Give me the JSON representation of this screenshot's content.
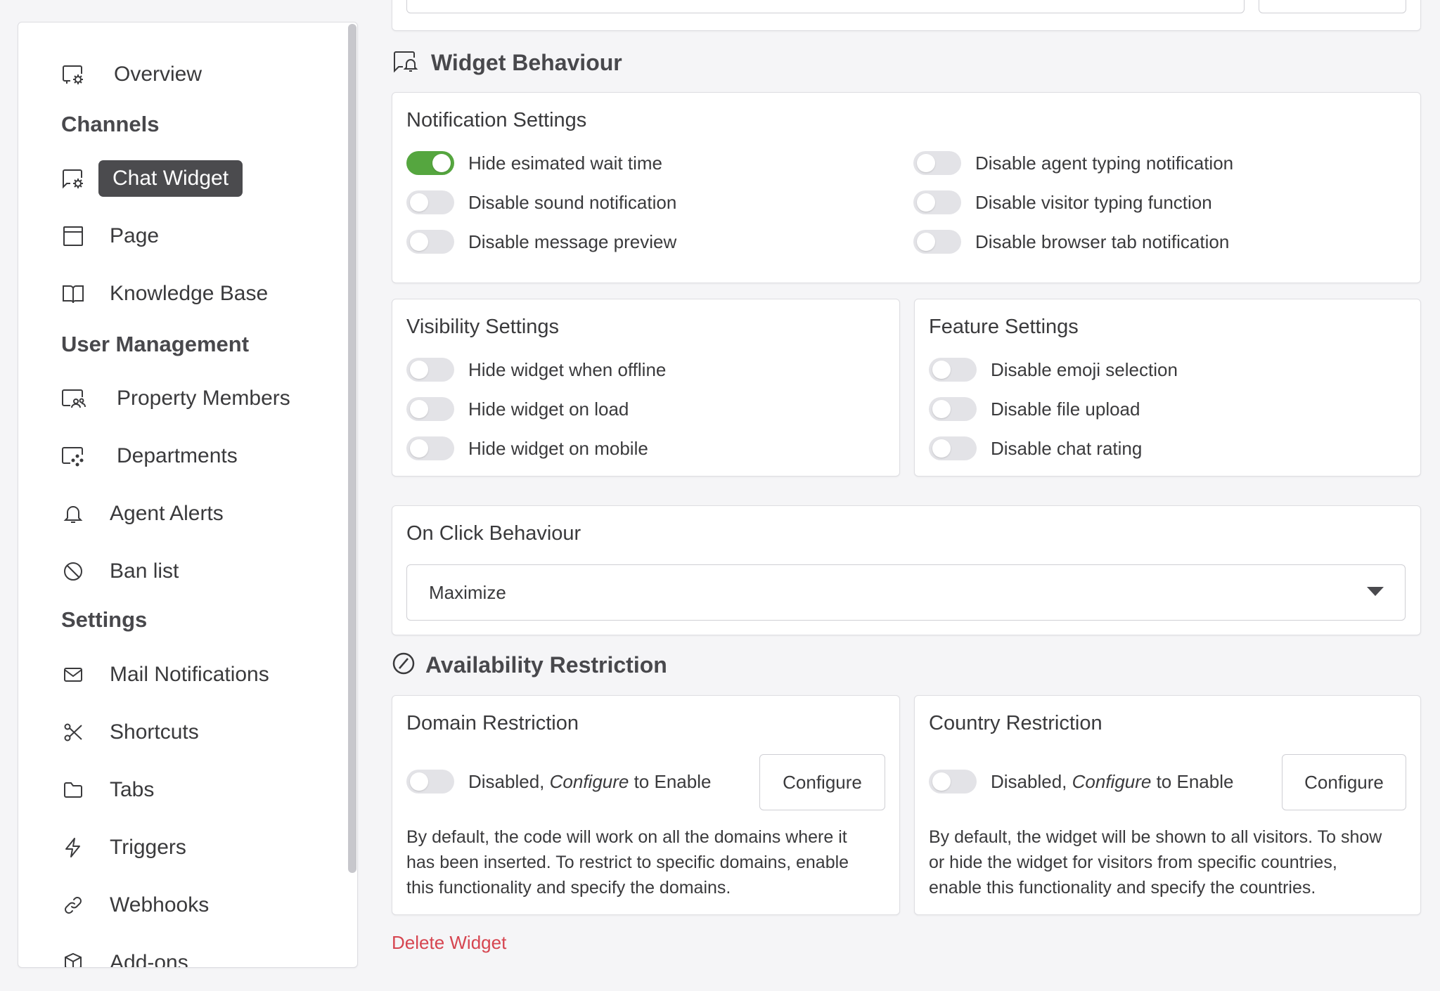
{
  "sidebar": {
    "overview": "Overview",
    "channels_title": "Channels",
    "chat_widget": "Chat Widget",
    "page": "Page",
    "knowledge_base": "Knowledge Base",
    "user_management_title": "User Management",
    "property_members": "Property Members",
    "departments": "Departments",
    "agent_alerts": "Agent Alerts",
    "ban_list": "Ban list",
    "settings_title": "Settings",
    "mail_notifications": "Mail Notifications",
    "shortcuts": "Shortcuts",
    "tabs": "Tabs",
    "triggers": "Triggers",
    "webhooks": "Webhooks",
    "addons": "Add-ons"
  },
  "widget_behaviour": {
    "title": "Widget Behaviour",
    "notification": {
      "title": "Notification Settings",
      "items": [
        {
          "label": "Hide esimated wait time",
          "on": true
        },
        {
          "label": "Disable sound notification",
          "on": false
        },
        {
          "label": "Disable message preview",
          "on": false
        },
        {
          "label": "Disable agent typing notification",
          "on": false
        },
        {
          "label": "Disable visitor typing function",
          "on": false
        },
        {
          "label": "Disable browser tab notification",
          "on": false
        }
      ]
    },
    "visibility": {
      "title": "Visibility Settings",
      "items": [
        {
          "label": "Hide widget when offline",
          "on": false
        },
        {
          "label": "Hide widget on load",
          "on": false
        },
        {
          "label": "Hide widget on mobile",
          "on": false
        }
      ]
    },
    "feature": {
      "title": "Feature Settings",
      "items": [
        {
          "label": "Disable emoji selection",
          "on": false
        },
        {
          "label": "Disable file upload",
          "on": false
        },
        {
          "label": "Disable chat rating",
          "on": false
        }
      ]
    },
    "on_click": {
      "title": "On Click Behaviour",
      "selected": "Maximize"
    }
  },
  "availability": {
    "title": "Availability Restriction",
    "domain": {
      "title": "Domain Restriction",
      "status_prefix": "Disabled, ",
      "status_em": "Configure",
      "status_suffix": " to Enable",
      "button": "Configure",
      "desc_lines": [
        "By default, the code will work on all the domains where it",
        "has been inserted. To restrict to specific domains, enable",
        "this functionality and specify the domains."
      ]
    },
    "country": {
      "title": "Country Restriction",
      "status_prefix": "Disabled, ",
      "status_em": "Configure",
      "status_suffix": " to Enable",
      "button": "Configure",
      "desc_lines": [
        "By default, the widget will be shown to all visitors. To show",
        "or hide the widget for visitors from specific countries,",
        "enable this functionality and specify the countries."
      ]
    }
  },
  "delete_widget": "Delete Widget",
  "colors": {
    "toggle_on": "#55a63f",
    "toggle_off": "#e3e3e7",
    "active_nav": "#4b4b4e",
    "danger": "#d64550"
  }
}
